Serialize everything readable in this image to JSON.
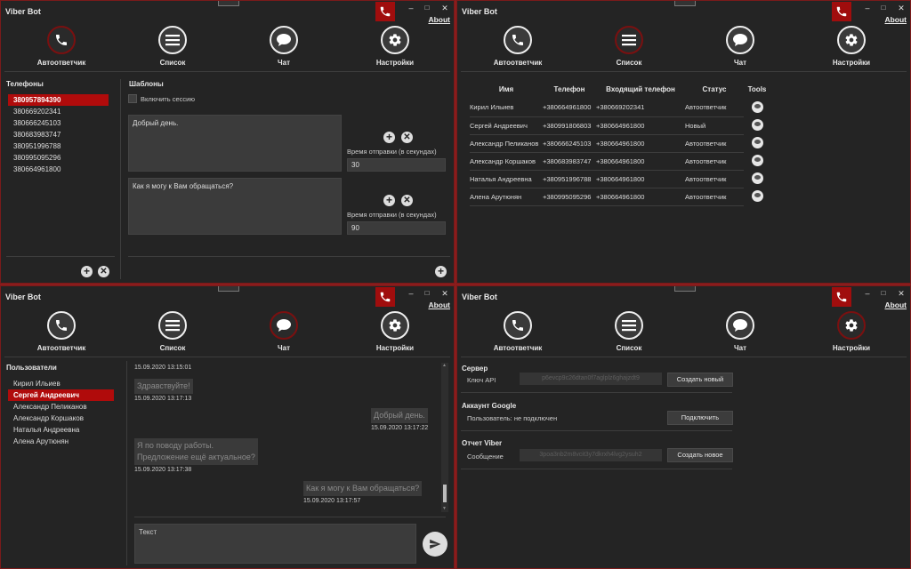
{
  "app": {
    "title": "Viber Bot",
    "about": "About"
  },
  "nav": {
    "auto": "Автоответчик",
    "list": "Список",
    "chat": "Чат",
    "settings": "Настройки"
  },
  "autoresponder": {
    "phones_title": "Телефоны",
    "phones": [
      "380957894390",
      "380669202341",
      "380666245103",
      "380683983747",
      "380951996788",
      "380995095296",
      "380664961800"
    ],
    "templates_title": "Шаблоны",
    "session_label": "Включить сессию",
    "templates": [
      {
        "text": "Добрый день.",
        "delay_label": "Время отправки (в секундах)",
        "delay": "30"
      },
      {
        "text": "Как я могу к Вам обращаться?",
        "delay_label": "Время отправки (в секундах)",
        "delay": "90"
      }
    ]
  },
  "list": {
    "headers": [
      "Имя",
      "Телефон",
      "Входящий телефон",
      "Статус",
      "Tools"
    ],
    "rows": [
      [
        "Кирил Ильиев",
        "+380664961800",
        "+380669202341",
        "Автоответчик"
      ],
      [
        "Сергей Андреевич",
        "+380991806803",
        "+380664961800",
        "Новый"
      ],
      [
        "Александр Пеликанов",
        "+380666245103",
        "+380664961800",
        "Автоответчик"
      ],
      [
        "Александр Коршаков",
        "+380683983747",
        "+380664961800",
        "Автоответчик"
      ],
      [
        "Наталья Андреевна",
        "+380951996788",
        "+380664961800",
        "Автоответчик"
      ],
      [
        "Алена Арутюнян",
        "+380995095296",
        "+380664961800",
        "Автоответчик"
      ]
    ]
  },
  "chat": {
    "users_title": "Пользователи",
    "users": [
      "Кирил Ильиев",
      "Сергей Андреевич",
      "Александр Пеликанов",
      "Александр Коршаков",
      "Наталья Андреевна",
      "Алена Арутюнян"
    ],
    "first_ts": "15.09.2020 13:15:01",
    "messages": [
      {
        "side": "left",
        "text": "Здравствуйте!",
        "ts": "15.09.2020 13:17:13"
      },
      {
        "side": "right",
        "text": "Добрый день.",
        "ts": "15.09.2020 13:17:22"
      },
      {
        "side": "left",
        "text": "Я по поводу работы.\nПредложение ещё актуальное?",
        "ts": "15.09.2020 13:17:38"
      },
      {
        "side": "right",
        "text": "Как я могу к Вам обращаться?",
        "ts": "15.09.2020 13:17:57"
      }
    ],
    "input_placeholder": "Текст"
  },
  "settings": {
    "server_title": "Сервер",
    "api_label": "Ключ API",
    "api_key": "p6evcp9c26dtan0f7aglplz6ghajzdt9",
    "api_button": "Создать новый",
    "google_title": "Аккаунт Google",
    "google_user": "Пользователь: не подключен",
    "google_button": "Подключить",
    "viber_title": "Отчет Viber",
    "viber_label": "Сообщение",
    "viber_key": "3poa3nb2m8vcit3y7dkrxh4lvg2ysuh2",
    "viber_button": "Создать новое"
  },
  "colors": {
    "accent": "#a00d0d",
    "background": "#242424",
    "frame": "#8b1c1c"
  }
}
